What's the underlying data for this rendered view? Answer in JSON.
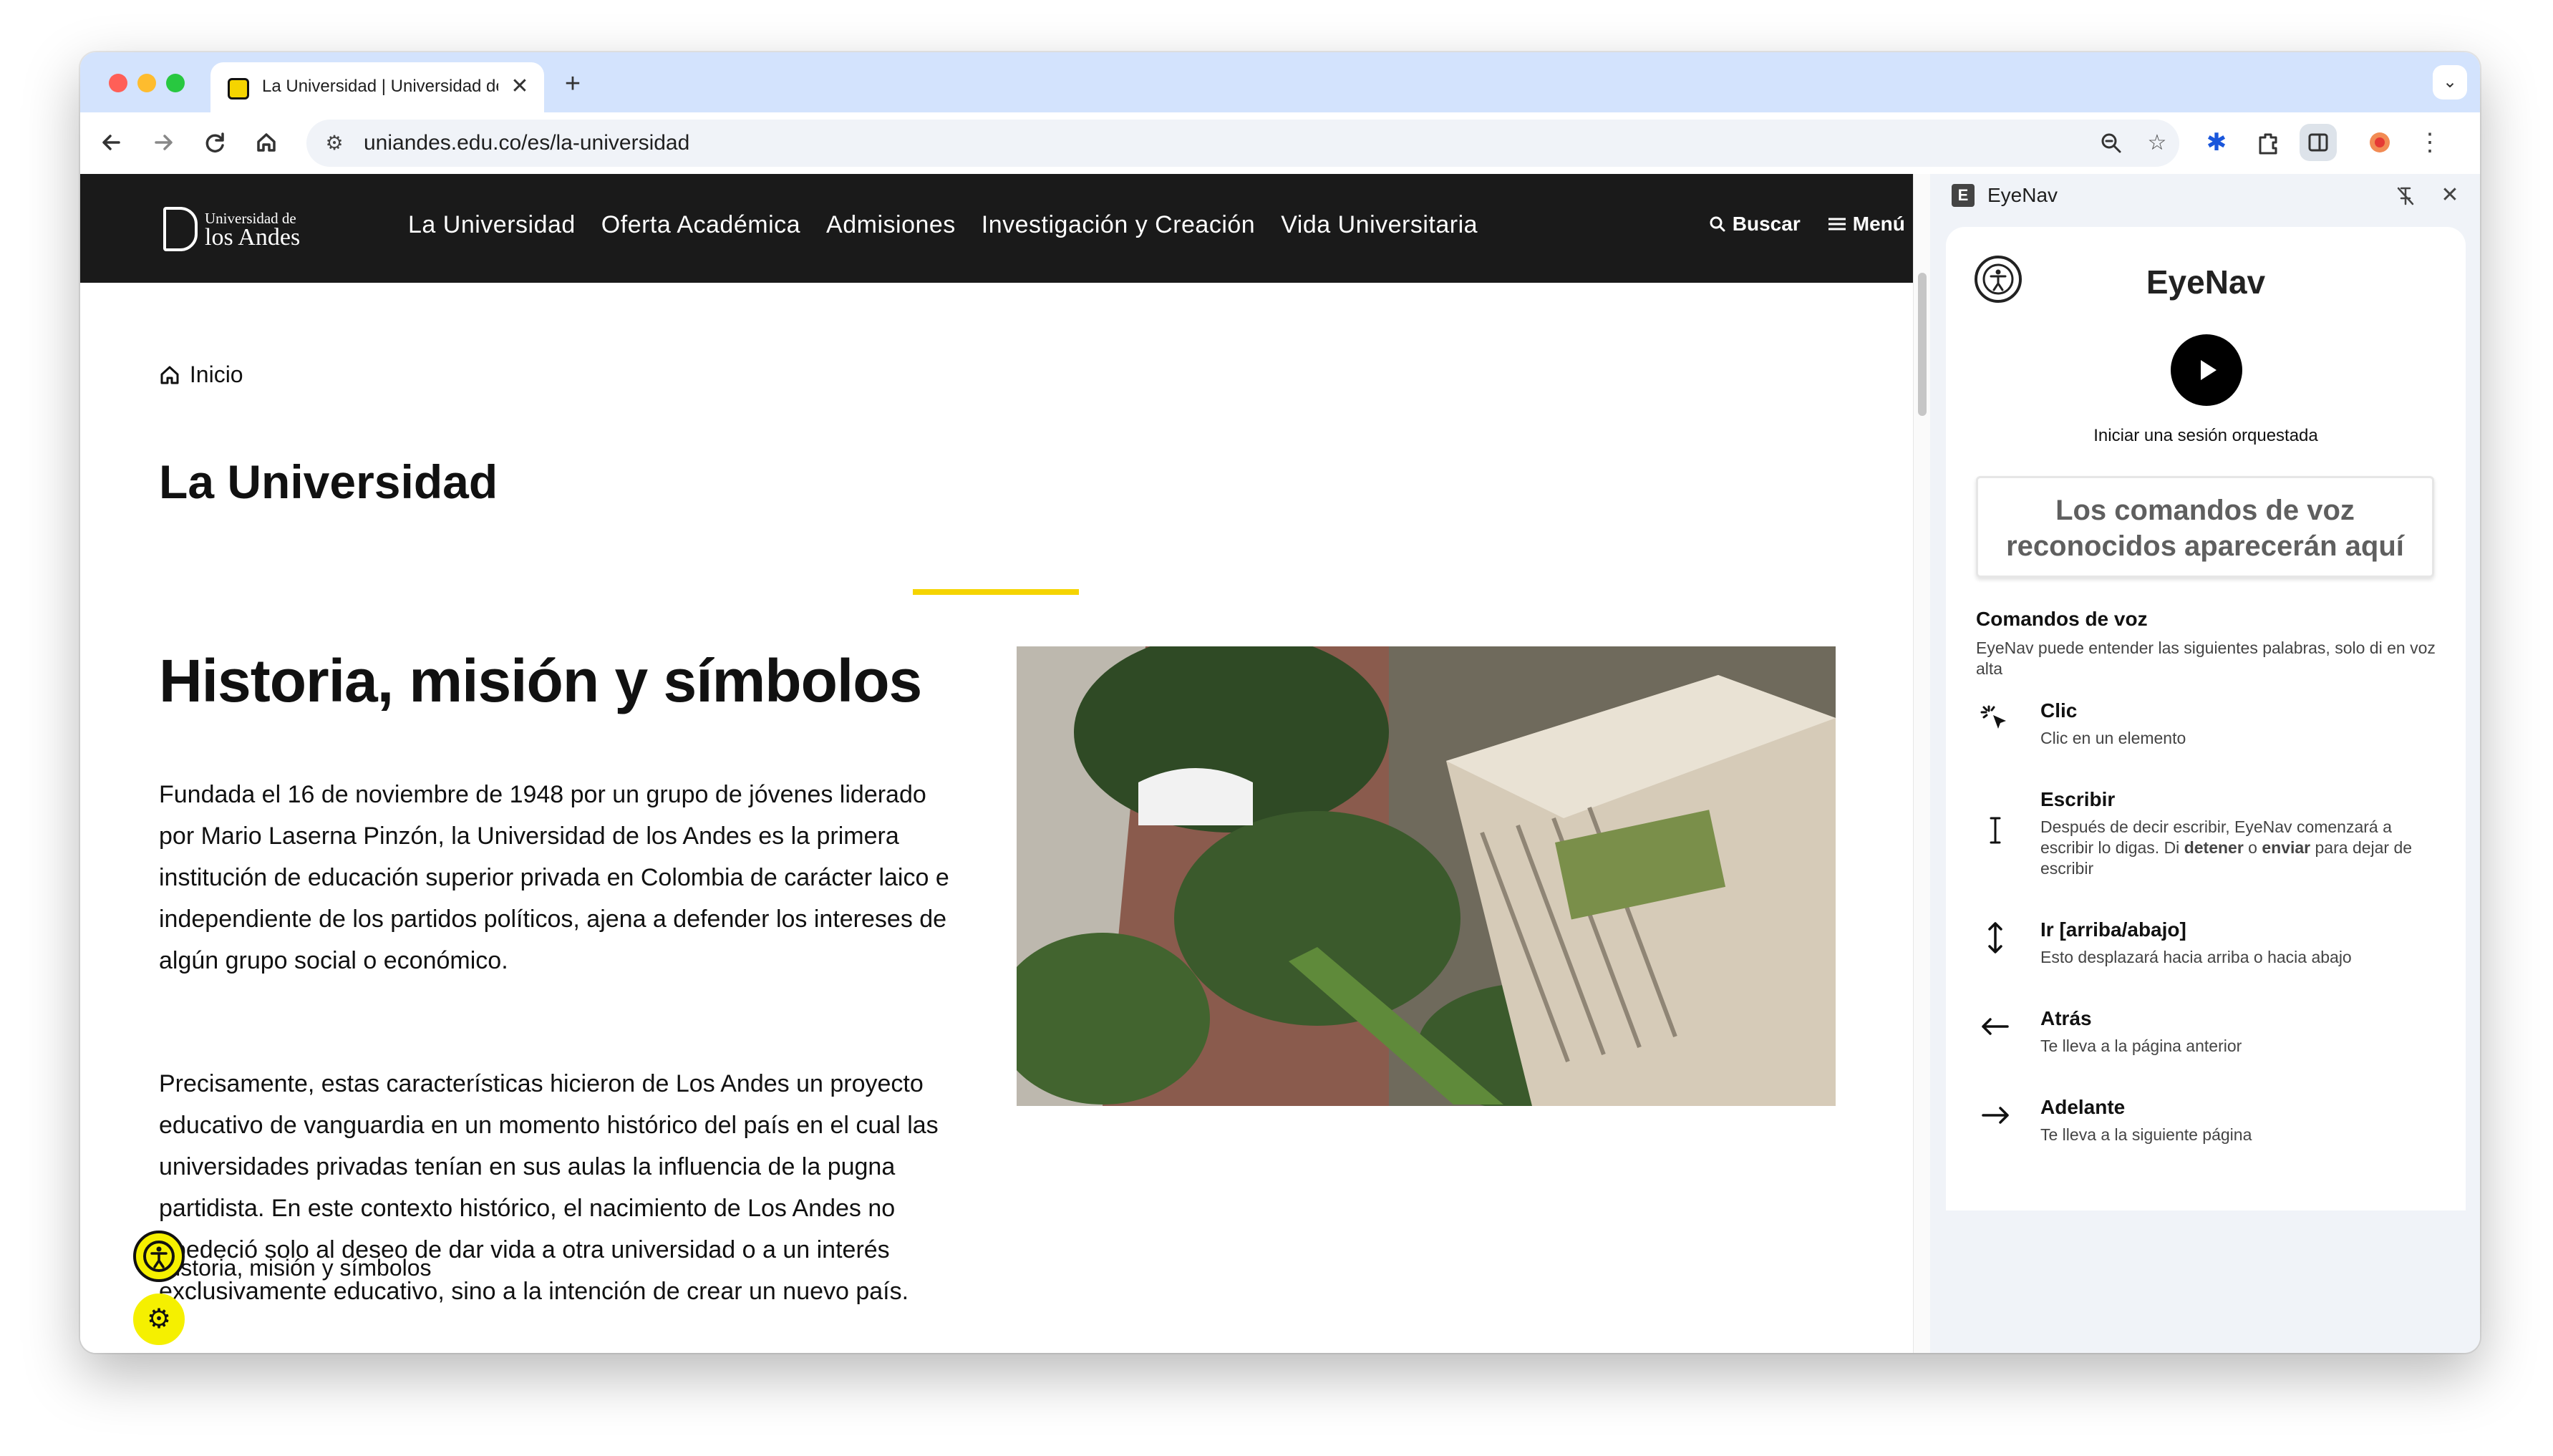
{
  "browser": {
    "tab_title": "La Universidad | Universidad de los Andes",
    "tab_close": "✕",
    "new_tab": "+",
    "tab_search": "⌄",
    "url": "uniandes.edu.co/es/la-universidad"
  },
  "site": {
    "logo_small": "Universidad de",
    "logo_big": "los Andes",
    "nav": [
      "La Universidad",
      "Oferta Académica",
      "Admisiones",
      "Investigación y Creación",
      "Vida Universitaria"
    ],
    "search_label": "Buscar",
    "menu_label": "Menú"
  },
  "page": {
    "breadcrumb": "Inicio",
    "title": "La Universidad",
    "section_title": "Historia, misión y símbolos",
    "paragraph1": "Fundada el 16 de noviembre de 1948 por un grupo de jóvenes liderado por Mario Laserna Pinzón, la Universidad de los Andes es la primera institución de educación superior privada en Colombia de carácter laico e independiente de los partidos políticos, ajena a defender los intereses de algún grupo social o económico.",
    "paragraph2": "Precisamente, estas características hicieron de Los Andes un proyecto educativo de vanguardia en un momento histórico del país en el cual las universidades privadas tenían en sus aulas la influencia de la pugna partidista. En este contexto histórico, el nacimiento de Los Andes no obedeció solo al deseo de dar vida a otra universidad o a un interés exclusivamente educativo, sino a la intención de crear un nuevo país.",
    "subnav_label": "Historia, misión y símbolos"
  },
  "panel": {
    "header_title": "EyeNav",
    "header_logo": "E",
    "ext_title": "EyeNav",
    "session_label": "Iniciar una sesión orquestada",
    "voice_placeholder": "Los comandos de voz reconocidos aparecerán aquí",
    "commands_title": "Comandos de voz",
    "commands_desc": "EyeNav puede entender las siguientes palabras, solo di en voz alta",
    "commands": [
      {
        "icon": "click-icon",
        "glyph": "✲",
        "title": "Clic",
        "desc": "Clic en un elemento"
      },
      {
        "icon": "text-cursor-icon",
        "glyph": "I",
        "title": "Escribir",
        "desc_parts": [
          "Después de decir escribir, EyeNav comenzará a escribir lo digas. Di ",
          "detener",
          " o ",
          "enviar",
          " para dejar de escribir"
        ]
      },
      {
        "icon": "up-down-arrow-icon",
        "glyph": "↕",
        "title": "Ir [arriba/abajo]",
        "desc": "Esto desplazará hacia arriba o hacia abajo"
      },
      {
        "icon": "arrow-left-icon",
        "glyph": "←",
        "title": "Atrás",
        "desc": "Te lleva a la página anterior"
      },
      {
        "icon": "arrow-right-icon",
        "glyph": "→",
        "title": "Adelante",
        "desc": "Te lleva a la siguiente página"
      }
    ]
  },
  "colors": {
    "accent_yellow": "#f5d400",
    "header_dark": "#1a1a1a",
    "tabstrip_blue": "#d3e3fd"
  }
}
